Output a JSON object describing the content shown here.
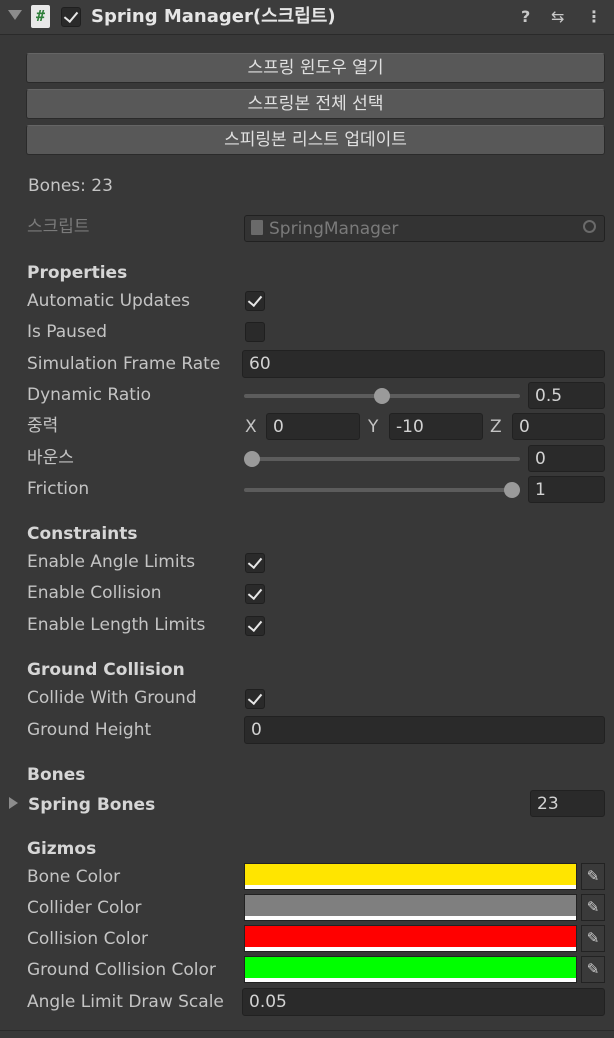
{
  "header": {
    "title": "Spring Manager(스크립트)",
    "help_icon": "?",
    "settings_icon": "⇆",
    "menu_icon": "⋮"
  },
  "buttons": {
    "open_window": "스프링 윈도우 열기",
    "select_all": "스프링본 전체 선택",
    "update_list": "스피링본 리스트 업데이트"
  },
  "bones_count_text": "Bones: 23",
  "script": {
    "label": "스크립트",
    "value": "SpringManager"
  },
  "properties": {
    "heading": "Properties",
    "automatic_updates": {
      "label": "Automatic Updates",
      "checked": true
    },
    "is_paused": {
      "label": "Is Paused",
      "checked": false
    },
    "simulation_frame_rate": {
      "label": "Simulation Frame Rate",
      "value": "60"
    },
    "dynamic_ratio": {
      "label": "Dynamic Ratio",
      "value": "0.5",
      "fraction": 0.5
    },
    "gravity": {
      "label": "중력",
      "x_label": "X",
      "x": "0",
      "y_label": "Y",
      "y": "-10",
      "z_label": "Z",
      "z": "0"
    },
    "bounce": {
      "label": "바운스",
      "value": "0",
      "fraction": 0.0
    },
    "friction": {
      "label": "Friction",
      "value": "1",
      "fraction": 1.0
    }
  },
  "constraints": {
    "heading": "Constraints",
    "enable_angle_limits": {
      "label": "Enable Angle Limits",
      "checked": true
    },
    "enable_collision": {
      "label": "Enable Collision",
      "checked": true
    },
    "enable_length_limits": {
      "label": "Enable Length Limits",
      "checked": true
    }
  },
  "ground_collision": {
    "heading": "Ground Collision",
    "collide_with_ground": {
      "label": "Collide With Ground",
      "checked": true
    },
    "ground_height": {
      "label": "Ground Height",
      "value": "0"
    }
  },
  "bones": {
    "heading": "Bones",
    "spring_bones": {
      "label": "Spring Bones",
      "size": "23"
    }
  },
  "gizmos": {
    "heading": "Gizmos",
    "bone_color": {
      "label": "Bone Color",
      "color": "#ffe500"
    },
    "collider_color": {
      "label": "Collider Color",
      "color": "#7f7f7f"
    },
    "collision_color": {
      "label": "Collision Color",
      "color": "#ff0000"
    },
    "ground_collision_color": {
      "label": "Ground Collision Color",
      "color": "#00ff00"
    },
    "angle_limit_draw_scale": {
      "label": "Angle Limit Draw Scale",
      "value": "0.05"
    }
  }
}
